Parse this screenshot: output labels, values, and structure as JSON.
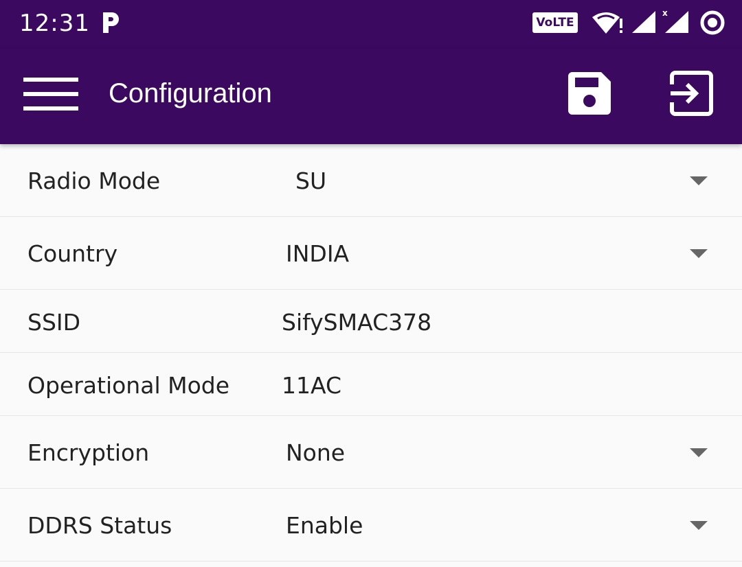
{
  "status_bar": {
    "time": "12:31",
    "app_icon": "p-icon",
    "volte_label": "VoLTE",
    "icons": [
      "wifi-icon",
      "signal-icon",
      "signal-icon",
      "record-icon"
    ]
  },
  "app_bar": {
    "title": "Configuration",
    "menu_icon": "hamburger-menu-icon",
    "save_icon": "save-icon",
    "exit_icon": "logout-icon",
    "background_color": "#3b0960"
  },
  "settings": [
    {
      "label": "Radio Mode",
      "value": "SU",
      "dropdown": true
    },
    {
      "label": "Country",
      "value": "INDIA",
      "dropdown": true
    },
    {
      "label": "SSID",
      "value": "SifySMAC378",
      "dropdown": false
    },
    {
      "label": "Operational Mode",
      "value": "11AC",
      "dropdown": false
    },
    {
      "label": "Encryption",
      "value": "None",
      "dropdown": true
    },
    {
      "label": "DDRS Status",
      "value": "Enable",
      "dropdown": true
    }
  ]
}
